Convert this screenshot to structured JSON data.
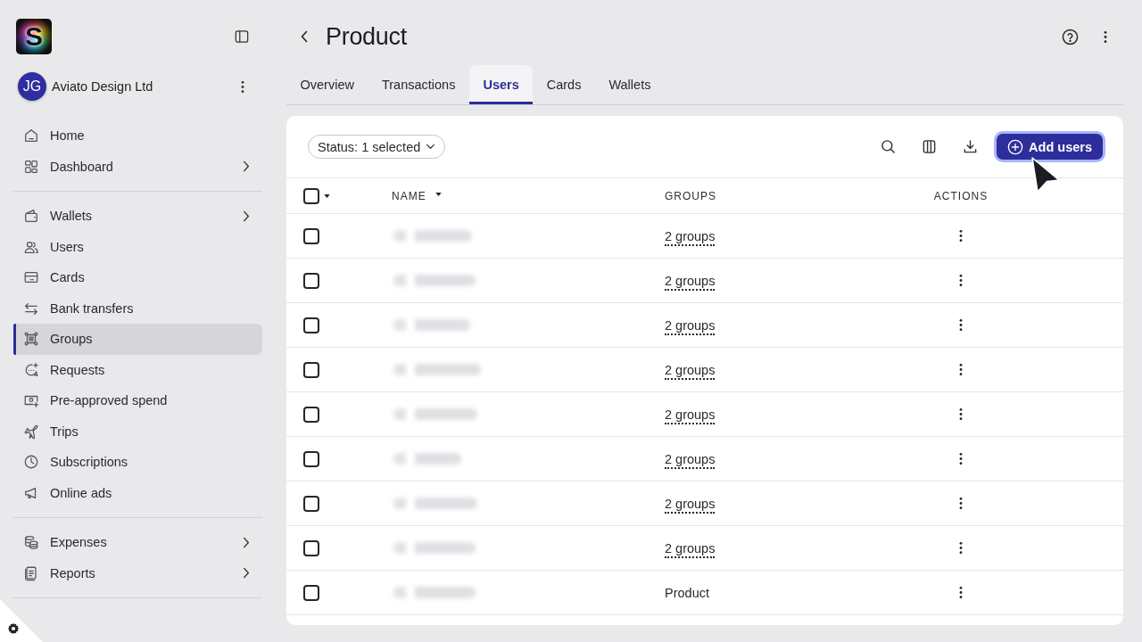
{
  "sidebar": {
    "logo": {
      "letter": "S"
    },
    "account": {
      "initials": "JG",
      "name": "Aviato Design Ltd"
    },
    "sections": [
      {
        "items": [
          {
            "label": "Home",
            "selected": false,
            "submenu": false
          },
          {
            "label": "Dashboard",
            "selected": false,
            "submenu": true
          }
        ]
      },
      {
        "items": [
          {
            "label": "Wallets",
            "selected": false,
            "submenu": true
          },
          {
            "label": "Users",
            "selected": false,
            "submenu": false
          },
          {
            "label": "Cards",
            "selected": false,
            "submenu": false
          },
          {
            "label": "Bank transfers",
            "selected": false,
            "submenu": false
          },
          {
            "label": "Groups",
            "selected": true,
            "submenu": false
          },
          {
            "label": "Requests",
            "selected": false,
            "submenu": false
          },
          {
            "label": "Pre-approved spend",
            "selected": false,
            "submenu": false
          },
          {
            "label": "Trips",
            "selected": false,
            "submenu": false
          },
          {
            "label": "Subscriptions",
            "selected": false,
            "submenu": false
          },
          {
            "label": "Online ads",
            "selected": false,
            "submenu": false
          }
        ]
      },
      {
        "items": [
          {
            "label": "Expenses",
            "selected": false,
            "submenu": true
          },
          {
            "label": "Reports",
            "selected": false,
            "submenu": true
          }
        ]
      }
    ]
  },
  "header": {
    "title": "Product"
  },
  "tabs": [
    {
      "label": "Overview",
      "selected": false
    },
    {
      "label": "Transactions",
      "selected": false
    },
    {
      "label": "Users",
      "selected": true
    },
    {
      "label": "Cards",
      "selected": false
    },
    {
      "label": "Wallets",
      "selected": false
    }
  ],
  "toolbar": {
    "filter": "Status: 1 selected",
    "add_button": {
      "label": "Add users",
      "focused": true
    }
  },
  "table": {
    "select_all_checked": false,
    "columns": [
      {
        "label": "NAME",
        "sorted": true
      },
      {
        "label": "GROUPS",
        "sorted": false
      },
      {
        "label": "ACTIONS",
        "sorted": false
      }
    ],
    "rows": [
      {
        "checked": false,
        "kind": "count",
        "groups": "2 groups"
      },
      {
        "checked": false,
        "kind": "count",
        "groups": "2 groups"
      },
      {
        "checked": false,
        "kind": "count",
        "groups": "2 groups"
      },
      {
        "checked": false,
        "kind": "count",
        "groups": "2 groups"
      },
      {
        "checked": false,
        "kind": "count",
        "groups": "2 groups"
      },
      {
        "checked": false,
        "kind": "count",
        "groups": "2 groups"
      },
      {
        "checked": false,
        "kind": "count",
        "groups": "2 groups"
      },
      {
        "checked": false,
        "kind": "count",
        "groups": "2 groups"
      },
      {
        "checked": false,
        "kind": "name",
        "groups": "Product"
      }
    ]
  }
}
